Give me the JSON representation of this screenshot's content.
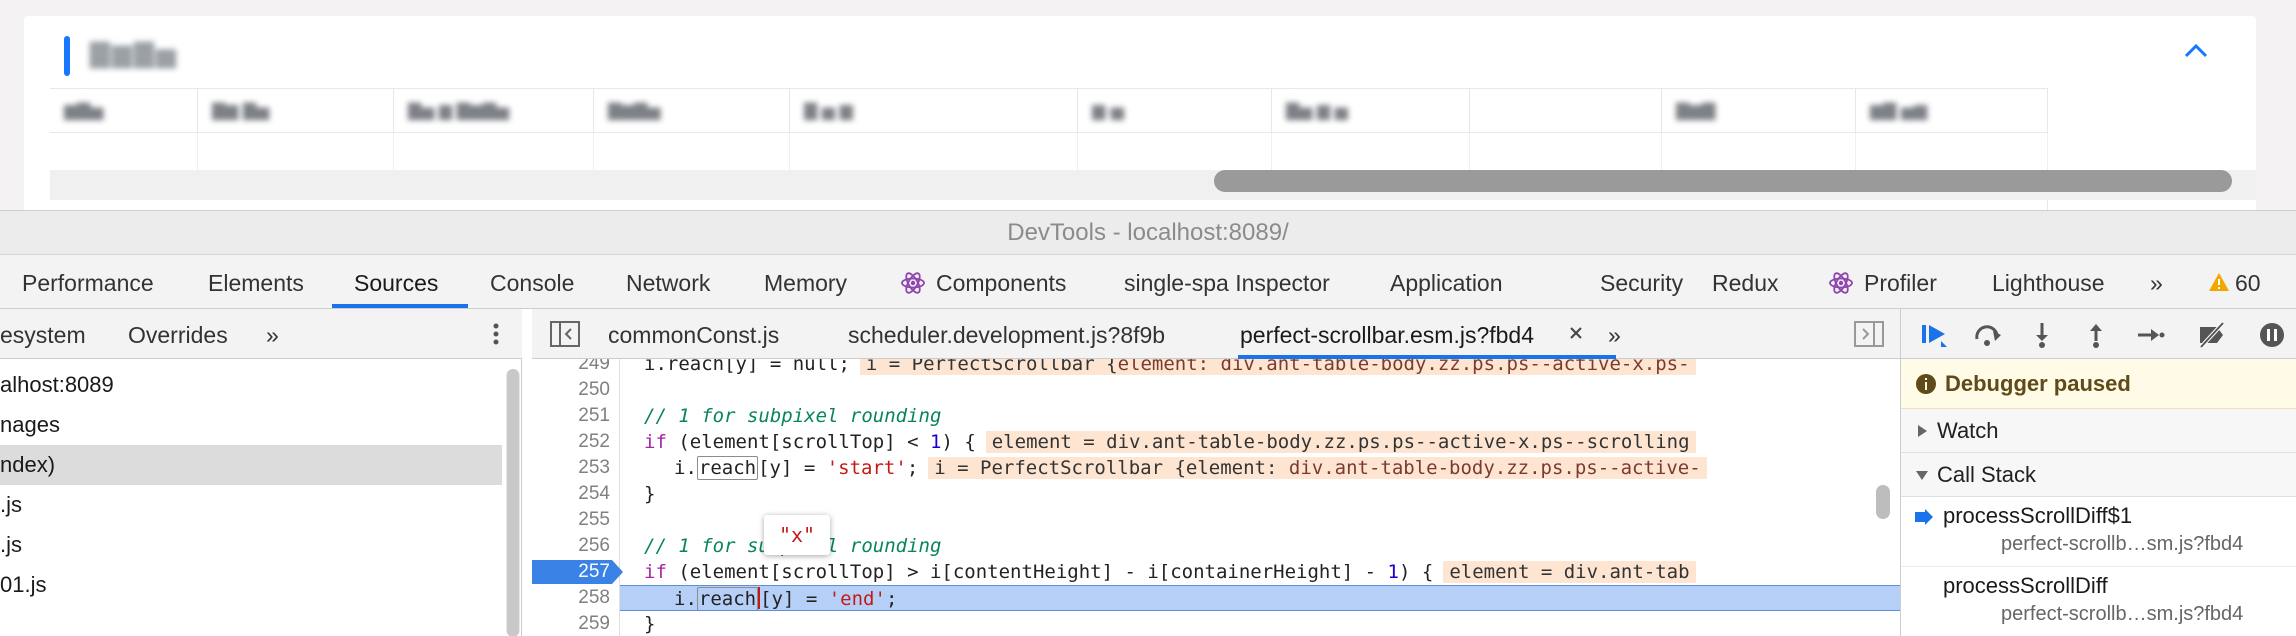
{
  "host_page": {
    "section_title": "▇▆▇▅",
    "table_headers": [
      "▆▇▅",
      "▇▆ ▇▅",
      "▇▅ ▆ ▇▆▇▅",
      "▇▆▇▅",
      "▇ ▅ ▆",
      "▆·▅",
      "▇▅ ▆ ▅",
      "",
      "▇▆▇",
      "▆▇ ▅▆"
    ]
  },
  "window": {
    "title": "DevTools - localhost:8089/"
  },
  "panel_tabs": {
    "performance": "Performance",
    "elements": "Elements",
    "sources": "Sources",
    "console": "Console",
    "network": "Network",
    "memory": "Memory",
    "components": "Components",
    "single_spa": "single-spa Inspector",
    "application": "Application",
    "security": "Security",
    "redux": "Redux",
    "profiler": "Profiler",
    "lighthouse": "Lighthouse",
    "more": "»",
    "warning_count": "60"
  },
  "navigator": {
    "tabs": {
      "filesystem": "esystem",
      "overrides": "Overrides",
      "more": "»"
    },
    "items": [
      "alhost:8089",
      "nages",
      "ndex)",
      ".js",
      ".js",
      "01.js"
    ]
  },
  "editor": {
    "file_tabs": {
      "common_const": "commonConst.js",
      "scheduler": "scheduler.development.js?8f9b",
      "perfect_scrollbar": "perfect-scrollbar.esm.js?fbd4",
      "more": "»"
    },
    "line_numbers": [
      "249",
      "250",
      "251",
      "252",
      "253",
      "254",
      "255",
      "256",
      "257",
      "258",
      "259"
    ],
    "lines": {
      "l249_code": "i.reach[y] = null;",
      "l249_inline": "i = PerfectScrollbar {",
      "l249_inline_el": "element: div.ant-table-body.zz.ps.ps--active-x.ps-",
      "l251_comment": "// 1 for subpixel rounding",
      "l252_kw": "if",
      "l252_code": " (element[scrollTop] < ",
      "l252_num": "1",
      "l252_tail": ") {",
      "l252_inline": "element = div.ant-table-body.zz.ps.ps--active-x.ps--scrolling",
      "l253_pre": "i.",
      "l253_box": "reach",
      "l253_mid": "[y] = ",
      "l253_str": "'start'",
      "l253_end": ";",
      "l253_inline": "i = PerfectScrollbar {element: ",
      "l253_inline_el": "div.ant-table-body.zz.ps.ps--active-",
      "l254_code": "}",
      "l256_comment": "// 1 for subpixel rounding",
      "l257_kw": "if",
      "l257_code": " (element[scrollTop] > i[contentHeight] - i[containerHeight] - ",
      "l257_num": "1",
      "l257_tail": ") {",
      "l257_inline": "element = div.ant-tab",
      "l258_pre": "i.",
      "l258_box": "reach",
      "l258_mid": "[y] = ",
      "l258_str": "'end'",
      "l258_end": ";",
      "l259_code": "}"
    },
    "hover_value": "\"x\""
  },
  "debugger": {
    "paused_text": "Debugger paused",
    "watch_label": "Watch",
    "call_stack_label": "Call Stack",
    "frames": [
      {
        "name": "processScrollDiff$1",
        "location": "perfect-scrollb…sm.js?fbd4"
      },
      {
        "name": "processScrollDiff",
        "location": "perfect-scrollb…sm.js?fbd4"
      }
    ]
  },
  "colors": {
    "accent": "#1a73e8",
    "paused_line": "#b5cff7",
    "breakpoint": "#3b82e6",
    "inline_value_bg": "#fde5d1",
    "paused_banner": "#fffbe6"
  }
}
